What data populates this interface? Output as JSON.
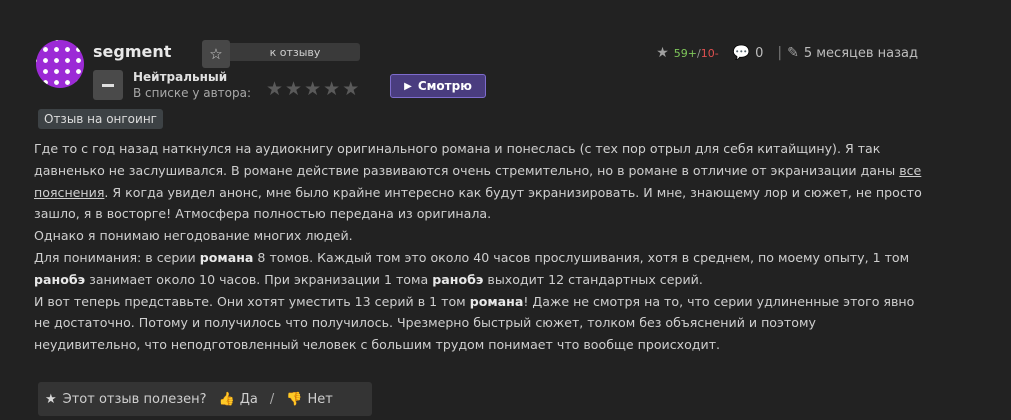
{
  "author": {
    "username": "segment",
    "avatar_color": "#9c2ad6"
  },
  "header": {
    "to_review_label": "к отзыву",
    "rating_plus": "59+",
    "rating_slash": " / ",
    "rating_minus": "10-",
    "comments_count": "0",
    "posted_ago": "5 месяцев назад"
  },
  "status": {
    "label": "Нейтральный",
    "in_list_label": "В списке у автора:",
    "stars_total": 5,
    "stars_filled": 0,
    "watch_label": "Смотрю",
    "watch_color": "#4a3d7f"
  },
  "tag": {
    "label": "Отзыв на онгоинг"
  },
  "review": {
    "p1": "Где то с год назад наткнулся на аудиокнигу оригинального романа и понеслась (с тех пор отрыл для себя китайщину). Я так давненько не заслушивался. В романе действие развиваются очень стремительно, но в романе в отличие от экранизации даны ",
    "p1_link": "все пояснения",
    "p1_end": ". Я когда увидел анонс, мне было крайне интересно как будут экранизировать. И мне, знающему лор и сюжет, не просто зашло, я в восторге! Атмосфера полностью передана из оригинала.",
    "p2": "Однако я понимаю негодование многих людей.",
    "p3_a": "Для понимания: в серии ",
    "p3_b1": "романа",
    "p3_c": " 8 томов. Каждый том это около 40 часов прослушивания, хотя в среднем, по моему опыту, 1 том ",
    "p3_b2": "ранобэ",
    "p3_d": " занимает около 10 часов. При экранизации 1 тома ",
    "p3_b3": "ранобэ",
    "p3_e": " выходит 12 стандартных серий.",
    "p4_a": "И вот теперь представьте. Они хотят уместить 13 серий в 1 том ",
    "p4_b": "романа",
    "p4_c": "! Даже не смотря на то, что серии удлиненные этого явно не достаточно. Потому и получилось что получилось. Чрезмерно быстрый сюжет, толком без объяснений и поэтому неудивительно, что неподготовленный человек с большим трудом понимает что вообще происходит."
  },
  "helpful": {
    "question": "Этот отзыв полезен?",
    "yes_label": "Да",
    "separator": "/",
    "no_label": "Нет"
  }
}
